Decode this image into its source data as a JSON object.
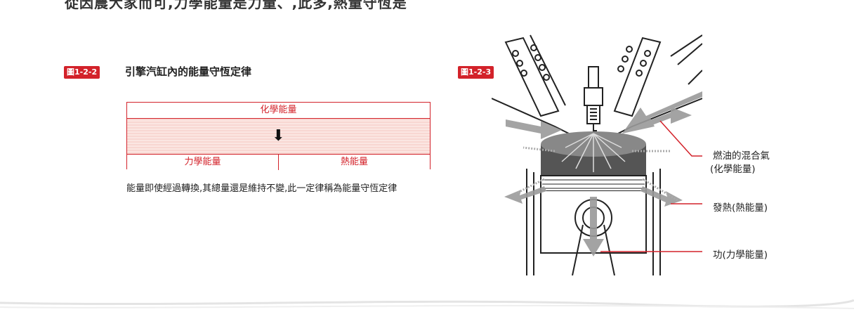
{
  "top_text": "從因農大家而可,力學能量是力量、,此多,熱量守恆是",
  "figure_left": {
    "badge": "圖1-2-2",
    "title": "引擎汽缸內的能量守恆定律",
    "top_label": "化學能量",
    "arrow": "⬇",
    "bottom_left_label": "力學能量",
    "bottom_right_label": "熱能量",
    "caption": "能量即使經過轉換,其總量還是維持不變,此一定律稱為能量守恆定律"
  },
  "figure_right": {
    "badge": "圖1-2-3",
    "label_fuel": "燃油的混合氣",
    "label_fuel_sub": "(化學能量)",
    "label_heat": "發熱(熱能量)",
    "label_work": "功(力學能量)"
  },
  "colors": {
    "accent": "#d3222a",
    "fill": "#fbe6e2",
    "arrow_gray": "#9a9a9a"
  }
}
